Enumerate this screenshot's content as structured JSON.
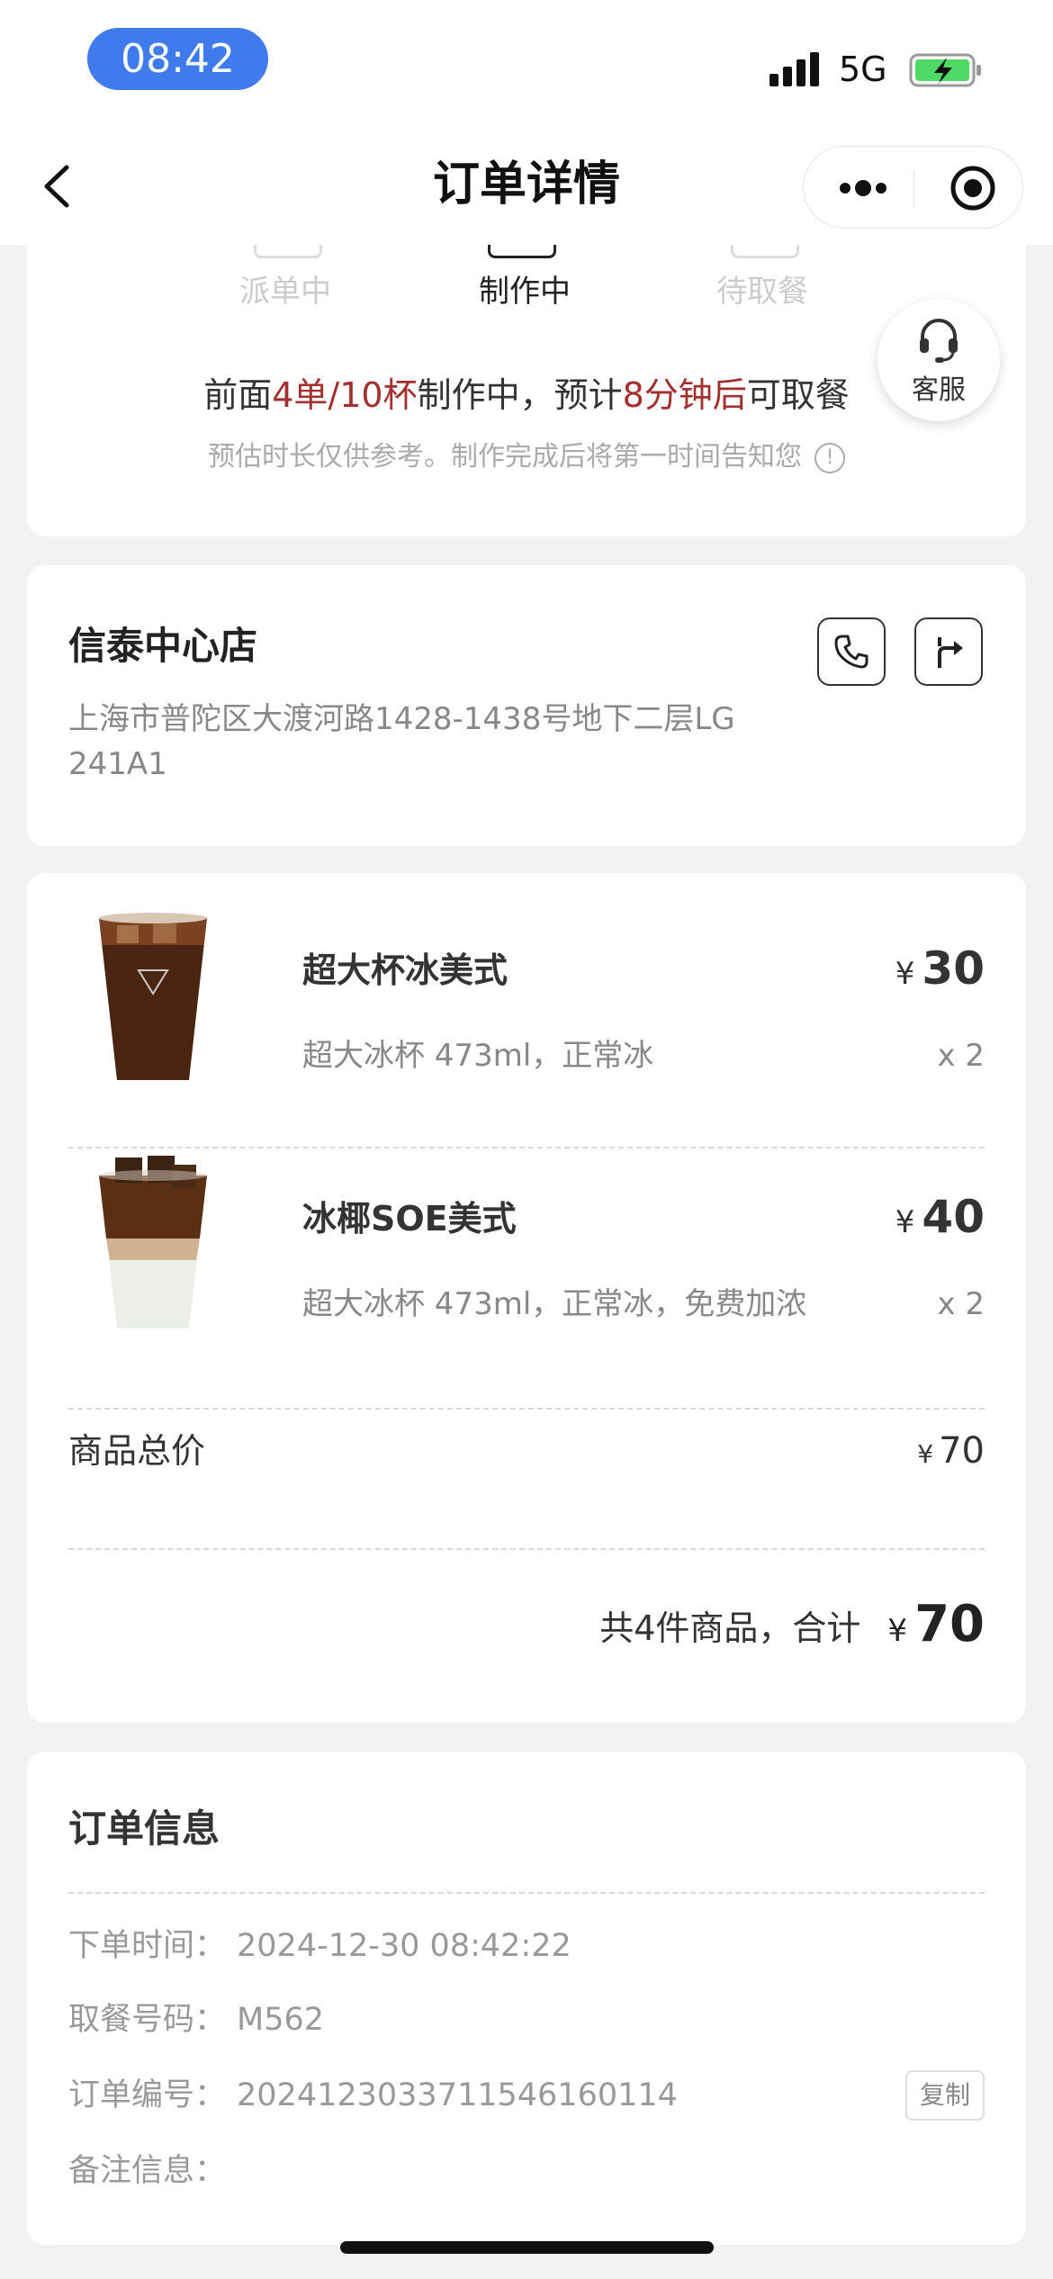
{
  "status_bar": {
    "time": "08:42",
    "network": "5G",
    "battery_color": "#4cd964"
  },
  "nav": {
    "title": "订单详情",
    "more_icon": "more-dots-icon",
    "target_icon": "target-icon"
  },
  "progress": {
    "steps": [
      "派单中",
      "制作中",
      "待取餐"
    ],
    "active_step": 1,
    "text_prefix": "前面",
    "queue": "4单/10杯",
    "text_mid": "制作中，预计",
    "eta": "8分钟后",
    "text_suffix": "可取餐",
    "hint": "预估时长仅供参考。制作完成后将第一时间告知您",
    "hint_icon": "!",
    "highlight_color": "#a3302e"
  },
  "customer_service": {
    "label": "客服",
    "icon": "headset-icon"
  },
  "store": {
    "name": "信泰中心店",
    "address": "上海市普陀区大渡河路1428-1438号地下二层LG 241A1",
    "call_icon": "phone-icon",
    "nav_icon": "navigate-icon"
  },
  "products": [
    {
      "name": "超大杯冰美式",
      "spec": "超大冰杯 473ml，正常冰",
      "currency": "¥",
      "price": "30",
      "qty": "x 2"
    },
    {
      "name": "冰椰SOE美式",
      "spec": "超大冰杯 473ml，正常冰，免费加浓",
      "currency": "¥",
      "price": "40",
      "qty": "x 2"
    }
  ],
  "summary": {
    "subtotal_label": "商品总价",
    "subtotal_currency": "¥",
    "subtotal": "70",
    "total_label": "共4件商品，合计",
    "total_currency": "¥",
    "total": "70"
  },
  "order_info": {
    "title": "订单信息",
    "time_label": "下单时间：",
    "time": "2024-12-30 08:42:22",
    "pickup_label": "取餐号码：",
    "pickup": "M562",
    "number_label": "订单编号：",
    "number": "20241230337115461601​14",
    "copy_label": "复制",
    "note_label": "备注信息："
  }
}
